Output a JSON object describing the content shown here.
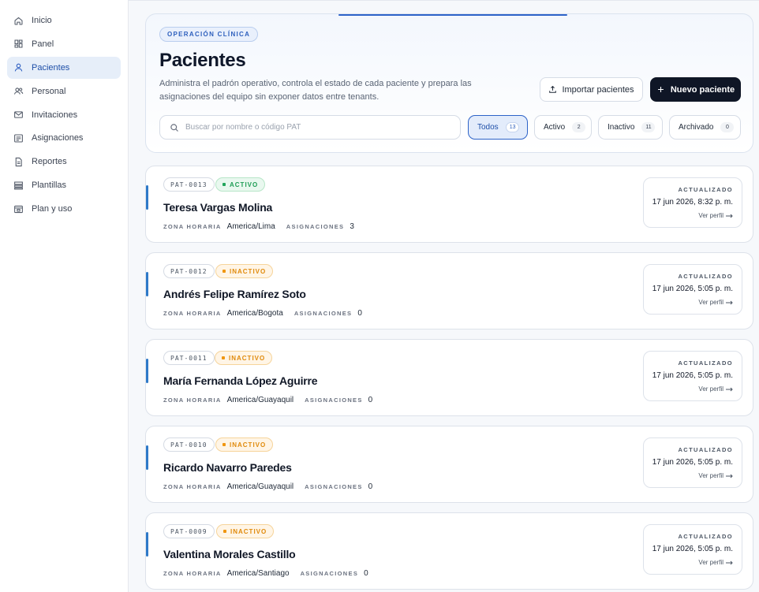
{
  "sidebar": {
    "items": [
      {
        "label": "Inicio",
        "icon": "home-icon",
        "active": false
      },
      {
        "label": "Panel",
        "icon": "grid-icon",
        "active": false
      },
      {
        "label": "Pacientes",
        "icon": "user-icon",
        "active": true
      },
      {
        "label": "Personal",
        "icon": "users-icon",
        "active": false
      },
      {
        "label": "Invitaciones",
        "icon": "mail-icon",
        "active": false
      },
      {
        "label": "Asignaciones",
        "icon": "list-icon",
        "active": false
      },
      {
        "label": "Reportes",
        "icon": "file-icon",
        "active": false
      },
      {
        "label": "Plantillas",
        "icon": "layers-icon",
        "active": false
      },
      {
        "label": "Plan y uso",
        "icon": "wallet-icon",
        "active": false
      }
    ]
  },
  "header": {
    "eyebrow": "OPERACIÓN CLÍNICA",
    "title": "Pacientes",
    "description": "Administra el padrón operativo, controla el estado de cada paciente y prepara las asignaciones del equipo sin exponer datos entre tenants.",
    "import_label": "Importar pacientes",
    "new_label": "Nuevo paciente"
  },
  "search": {
    "placeholder": "Buscar por nombre o código PAT",
    "value": ""
  },
  "filters": [
    {
      "label": "Todos",
      "count": "13",
      "active": true
    },
    {
      "label": "Activo",
      "count": "2",
      "active": false
    },
    {
      "label": "Inactivo",
      "count": "11",
      "active": false
    },
    {
      "label": "Archivado",
      "count": "0",
      "active": false
    }
  ],
  "labels": {
    "timezone": "ZONA HORARIA",
    "assignments": "ASIGNACIONES",
    "updated": "ACTUALIZADO",
    "view_profile": "Ver perfil"
  },
  "patients": [
    {
      "code": "PAT-0013",
      "status": "ACTIVO",
      "status_kind": "active",
      "name": "Teresa Vargas Molina",
      "timezone": "America/Lima",
      "assignments": "3",
      "updated": "17 jun 2026, 8:32 p. m."
    },
    {
      "code": "PAT-0012",
      "status": "INACTIVO",
      "status_kind": "inactive",
      "name": "Andrés Felipe Ramírez Soto",
      "timezone": "America/Bogota",
      "assignments": "0",
      "updated": "17 jun 2026, 5:05 p. m."
    },
    {
      "code": "PAT-0011",
      "status": "INACTIVO",
      "status_kind": "inactive",
      "name": "María Fernanda López Aguirre",
      "timezone": "America/Guayaquil",
      "assignments": "0",
      "updated": "17 jun 2026, 5:05 p. m."
    },
    {
      "code": "PAT-0010",
      "status": "INACTIVO",
      "status_kind": "inactive",
      "name": "Ricardo Navarro Paredes",
      "timezone": "America/Guayaquil",
      "assignments": "0",
      "updated": "17 jun 2026, 5:05 p. m."
    },
    {
      "code": "PAT-0009",
      "status": "INACTIVO",
      "status_kind": "inactive",
      "name": "Valentina Morales Castillo",
      "timezone": "America/Santiago",
      "assignments": "0",
      "updated": "17 jun 2026, 5:05 p. m."
    }
  ]
}
